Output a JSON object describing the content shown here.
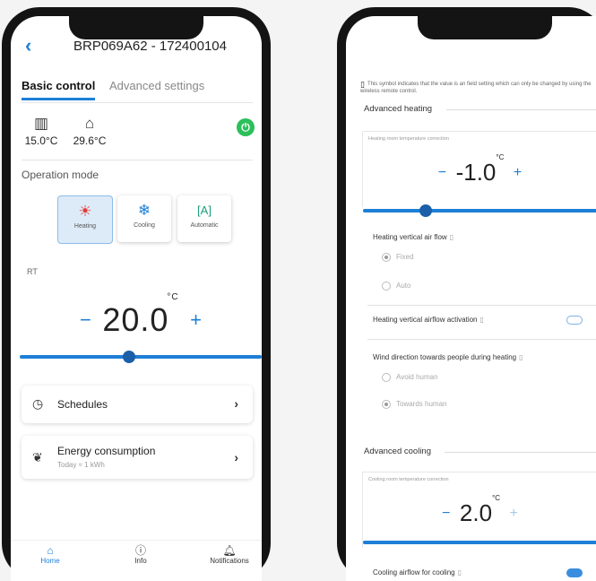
{
  "left": {
    "header": {
      "back_icon": "chevron-left-icon",
      "title": "BRP069A62 - 172400104"
    },
    "tabs": [
      {
        "label": "Basic control",
        "active": true
      },
      {
        "label": "Advanced settings",
        "active": false
      }
    ],
    "temps": [
      {
        "icon": "indoor-level-icon",
        "value": "15.0°C"
      },
      {
        "icon": "outdoor-house-icon",
        "value": "29.6°C"
      }
    ],
    "power": {
      "icon": "power-icon",
      "color": "#2cbf5a",
      "state": "on"
    },
    "operation_mode": {
      "label": "Operation mode",
      "modes": [
        {
          "label": "Heating",
          "icon": "sun-icon",
          "selected": true
        },
        {
          "label": "Cooling",
          "icon": "snowflake-icon",
          "selected": false
        },
        {
          "label": "Automatic",
          "icon": "auto-mode-icon",
          "selected": false
        }
      ]
    },
    "setpoint": {
      "label": "RT",
      "minus": "−",
      "value": "20.0",
      "unit": "°C",
      "plus": "+",
      "slider_fraction": 0.45
    },
    "list": [
      {
        "icon": "clock-icon",
        "title": "Schedules",
        "sub": ""
      },
      {
        "icon": "leaf-icon",
        "title": "Energy consumption",
        "sub": "Today   ≈ 1 kWh"
      }
    ],
    "bottom_nav": [
      {
        "icon": "home-icon",
        "label": "Home",
        "active": true
      },
      {
        "icon": "info-icon",
        "label": "Info",
        "active": false
      },
      {
        "icon": "bell-icon",
        "label": "Notifications",
        "active": false
      }
    ]
  },
  "right": {
    "note": "This symbol indicates that the value is an field setting which can only be changed by using the wireless remote control.",
    "note_icon": "remote-control-icon",
    "advanced_heating": {
      "title": "Advanced heating",
      "correction_label": "Heating room temperature correction",
      "value": "-1.0",
      "unit": "°C",
      "minus": "−",
      "plus": "+",
      "slider_fraction": 0.24
    },
    "heating_airflow": {
      "label": "Heating vertical air flow",
      "options": [
        {
          "label": "Fixed",
          "selected": true
        },
        {
          "label": "Auto",
          "selected": false
        }
      ]
    },
    "heating_airflow_activation": {
      "label": "Heating vertical airflow activation",
      "on": false
    },
    "wind_direction": {
      "label": "Wind direction towards people during heating",
      "options": [
        {
          "label": "Avoid human",
          "selected": false
        },
        {
          "label": "Towards human",
          "selected": true
        }
      ]
    },
    "advanced_cooling": {
      "title": "Advanced cooling",
      "correction_label": "Cooling room temperature correction",
      "value": "2.0",
      "unit": "°C",
      "minus": "−",
      "plus": "+",
      "slider_fraction": 0.98
    },
    "cooling_airflow": {
      "label": "Cooling airflow for cooling",
      "on": true
    },
    "field_setting_icon": "remote-control-icon"
  }
}
